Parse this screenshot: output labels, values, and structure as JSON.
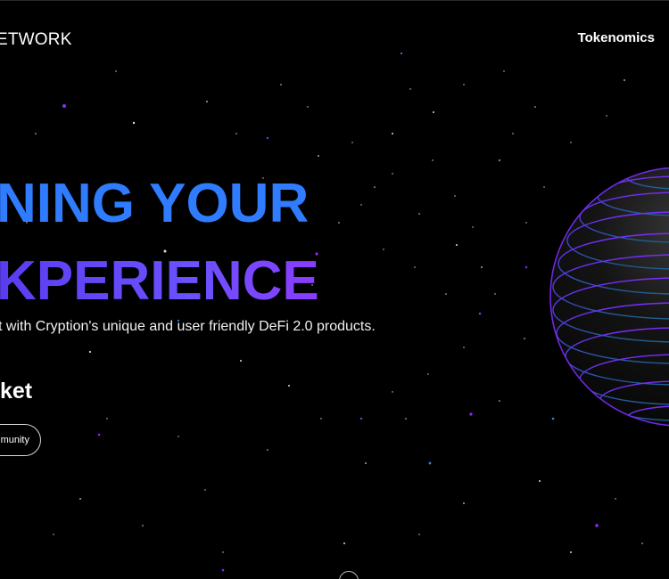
{
  "header": {
    "brand_text": "ETWORK",
    "nav_tokenomics": "Tokenomics"
  },
  "hero": {
    "line1": "NING YOUR",
    "line2": "KPERIENCE",
    "subtitle": "t with Cryption's unique and user friendly DeFi 2.0 products.",
    "market_text": "ket",
    "community_button": "munity"
  },
  "colors": {
    "background": "#000000",
    "line1": "#2f7cff",
    "line2": "#5e46ff",
    "text": "#ffffff",
    "globe_blue": "#1f5f8f",
    "globe_purple": "#7b2cff"
  },
  "icons": {
    "scroll": "scroll-down-circle-icon",
    "globe": "striped-globe-icon"
  }
}
